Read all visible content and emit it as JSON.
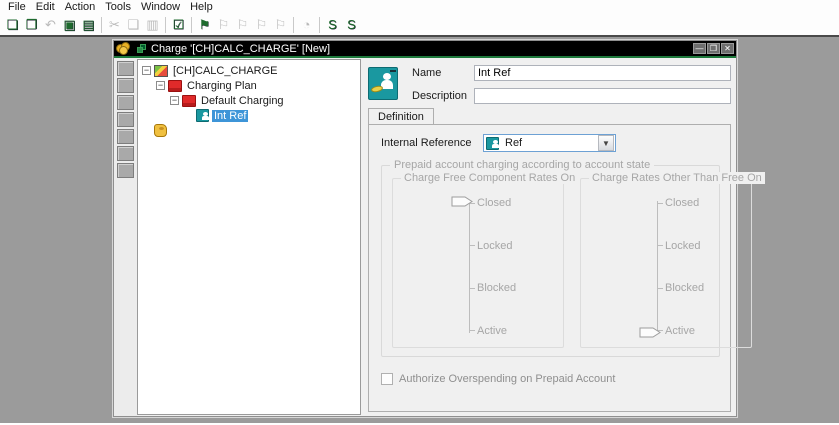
{
  "menu_bar": {
    "items": [
      {
        "label": "File"
      },
      {
        "label": "Edit"
      },
      {
        "label": "Action"
      },
      {
        "label": "Tools"
      },
      {
        "label": "Window"
      },
      {
        "label": "Help"
      }
    ]
  },
  "toolbar": {
    "icons": [
      {
        "name": "new-object-icon",
        "glyph": "❏",
        "tone": "color"
      },
      {
        "name": "duplicate-object-icon",
        "glyph": "❐",
        "tone": "color"
      },
      {
        "name": "link-icon",
        "glyph": "↶",
        "tone": "gray"
      },
      {
        "name": "edit-table-icon",
        "glyph": "▣",
        "tone": "color"
      },
      {
        "name": "save-table-icon",
        "glyph": "▤",
        "tone": "color"
      },
      {
        "name": "cut-icon",
        "glyph": "✂",
        "tone": "gray"
      },
      {
        "name": "copy-icon",
        "glyph": "❑",
        "tone": "gray"
      },
      {
        "name": "paste-icon",
        "glyph": "▥",
        "tone": "gray"
      },
      {
        "name": "validate-icon",
        "glyph": "☑",
        "tone": "color"
      },
      {
        "name": "deploy-icon",
        "glyph": "⚑",
        "tone": "color"
      },
      {
        "name": "deploy-2-icon",
        "glyph": "⚐",
        "tone": "gray"
      },
      {
        "name": "deploy-3-icon",
        "glyph": "⚐",
        "tone": "gray"
      },
      {
        "name": "deploy-4-icon",
        "glyph": "⚐",
        "tone": "gray"
      },
      {
        "name": "deploy-5-icon",
        "glyph": "⚐",
        "tone": "gray"
      },
      {
        "name": "history-icon",
        "glyph": "◔",
        "tone": "gray"
      },
      {
        "name": "script-1-icon",
        "glyph": "S",
        "tone": "color"
      },
      {
        "name": "script-2-icon",
        "glyph": "S",
        "tone": "color"
      }
    ]
  },
  "window": {
    "title": "Charge '[CH]CALC_CHARGE' [New]",
    "controls": {
      "minimize": "—",
      "maximize": "❐",
      "close": "✕"
    }
  },
  "tree": {
    "items": [
      {
        "label": "[CH]CALC_CHARGE",
        "icon": "chart-icon",
        "expander": "−",
        "selected": false
      },
      {
        "label": "Charging Plan",
        "icon": "red-board-icon",
        "expander": "−",
        "selected": false
      },
      {
        "label": "Default Charging",
        "icon": "red-board-icon",
        "expander": "−",
        "selected": false
      },
      {
        "label": "Int Ref",
        "icon": "teal-person-icon",
        "expander": "",
        "selected": true
      },
      {
        "label": "",
        "icon": "money-bag-icon",
        "expander": "",
        "selected": false
      }
    ]
  },
  "details": {
    "name_label": "Name",
    "name_value": "Int Ref",
    "description_label": "Description",
    "description_value": ""
  },
  "tabs": {
    "definition_label": "Definition"
  },
  "definition": {
    "internal_reference_label": "Internal Reference",
    "internal_reference_value": "Ref",
    "prepaid_group_label": "Prepaid account charging according to account state",
    "free_group_label": "Charge Free Component Rates On",
    "other_group_label": "Charge Rates Other Than Free On",
    "slider_labels": [
      "Closed",
      "Locked",
      "Blocked",
      "Active"
    ],
    "free_slider_value": "Closed",
    "other_slider_value": "Active",
    "checkbox_label": "Authorize Overspending on Prepaid Account",
    "checkbox_checked": false
  },
  "colors": {
    "titlebar_bg": "#000000",
    "titlebar_accent": "#1e7a3c",
    "selection_blue": "#3e95d8",
    "teal_icon": "#1a98a0",
    "red_icon": "#e02a2a",
    "desktop_gray": "#9b9b9b",
    "panel_gray": "#f0f0f0",
    "disabled_text": "#a6a6a6"
  }
}
